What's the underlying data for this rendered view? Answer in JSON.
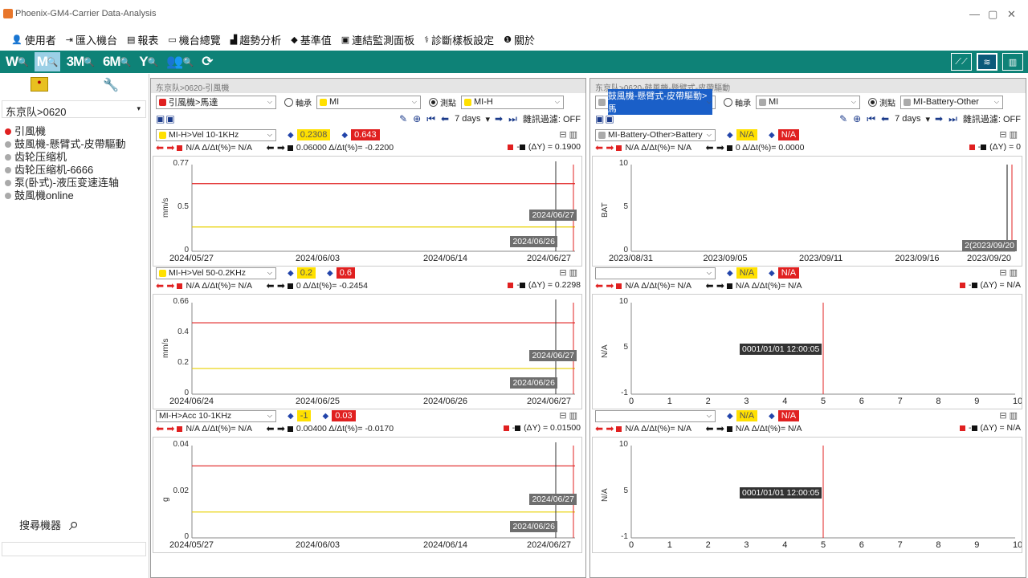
{
  "window": {
    "title": "Phoenix-GM4-Carrier Data-Analysis",
    "min": "—",
    "max": "▢",
    "close": "✕"
  },
  "menu": [
    {
      "icon": "user-icon",
      "glyph": "👤",
      "label": "使用者"
    },
    {
      "icon": "import-icon",
      "glyph": "⇥",
      "label": "匯入機台"
    },
    {
      "icon": "report-icon",
      "glyph": "▤",
      "label": "報表"
    },
    {
      "icon": "overview-icon",
      "glyph": "▭",
      "label": "機台總覽"
    },
    {
      "icon": "trend-icon",
      "glyph": "▟",
      "label": "趨勢分析"
    },
    {
      "icon": "baseline-icon",
      "glyph": "◆",
      "label": "基準值"
    },
    {
      "icon": "monitor-icon",
      "glyph": "▣",
      "label": "連結監測面板"
    },
    {
      "icon": "diagnose-icon",
      "glyph": "⚕",
      "label": "診斷樣板設定"
    },
    {
      "icon": "about-icon",
      "glyph": "❶",
      "label": "關於"
    }
  ],
  "toolbar": {
    "buttons": [
      {
        "name": "week-view-button",
        "label": "W",
        "active": false
      },
      {
        "name": "month-view-button",
        "label": "M",
        "active": true
      },
      {
        "name": "3month-view-button",
        "label": "3M",
        "active": false
      },
      {
        "name": "6month-view-button",
        "label": "6M",
        "active": false
      },
      {
        "name": "year-view-button",
        "label": "Y",
        "active": false
      },
      {
        "name": "user-search-button",
        "label": "👥",
        "active": false
      },
      {
        "name": "refresh-button",
        "label": "⟳",
        "active": false
      }
    ],
    "search_glyph": "🔍"
  },
  "sidebar": {
    "group_select": "东京队>0620",
    "tree": [
      {
        "label": "引風機",
        "status": "red"
      },
      {
        "label": "鼓風機-懸臂式-皮帶驅動",
        "status": "gray"
      },
      {
        "label": "齿轮压缩机",
        "status": "gray"
      },
      {
        "label": "齿轮压缩机-6666",
        "status": "gray"
      },
      {
        "label": "泵(卧式)-液压变速连轴",
        "status": "gray"
      },
      {
        "label": "鼓風機online",
        "status": "gray"
      }
    ],
    "search_label": "搜尋機器"
  },
  "panels": [
    {
      "breadcrumb": "东京队>0620-引風機",
      "machine_select": "引風機>馬達",
      "machine_dot": "#e02020",
      "axis_label": "軸承",
      "axis_select": "MI",
      "point_label": "測點",
      "point_select": "MI-H",
      "range": "7 days",
      "filter": "雜訊過濾: OFF",
      "sections": [
        {
          "select": "MI-H>Vel 10-1KHz",
          "sel_dot": "#ffe000",
          "low": "0.2308",
          "high": "0.643",
          "left_text": "N/A  Δ/Δt(%)=  N/A",
          "mid_text": "0.06000 Δ/Δt(%)=  -0.2200",
          "right_text": "(ΔY) =  0.1900",
          "chart_data": {
            "type": "line",
            "ylabel": "mm/s",
            "yticks": [
              "0.77",
              "0.5",
              "0"
            ],
            "xticks": [
              "2024/05/27",
              "2024/06/03",
              "2024/06/14",
              "2024/06/27"
            ],
            "tips": [
              "2024/06/27",
              "2024/06/26"
            ]
          }
        },
        {
          "select": "MI-H>Vel 50-0.2KHz",
          "sel_dot": "#ffe000",
          "low": "0.2",
          "high": "0.6",
          "left_text": "N/A  Δ/Δt(%)=  N/A",
          "mid_text": "0   Δ/Δt(%)=  -0.2454",
          "right_text": "(ΔY) =  0.2298",
          "chart_data": {
            "type": "line",
            "ylabel": "mm/s",
            "yticks": [
              "0.66",
              "0.4",
              "0.2",
              "0"
            ],
            "xticks": [
              "2024/06/24",
              "2024/06/25",
              "2024/06/26",
              "2024/06/27"
            ],
            "tips": [
              "2024/06/27",
              "2024/06/26"
            ]
          }
        },
        {
          "select": "MI-H>Acc 10-1KHz",
          "sel_dot": "",
          "low": "-1",
          "high": "0.03",
          "left_text": "N/A  Δ/Δt(%)=  N/A",
          "mid_text": "0.00400 Δ/Δt(%)=  -0.0170",
          "right_text": "(ΔY) =  0.01500",
          "chart_data": {
            "type": "line",
            "ylabel": "g",
            "yticks": [
              "0.04",
              "0.02",
              "0"
            ],
            "xticks": [
              "2024/05/27",
              "2024/06/03",
              "2024/06/14",
              "2024/06/27"
            ],
            "tips": [
              "2024/06/27",
              "2024/06/26"
            ]
          }
        }
      ]
    },
    {
      "breadcrumb": "东京队>0620-鼓風機-懸臂式-皮帶驅動",
      "machine_select": "鼓風機-懸臂式-皮帶驅動>馬",
      "machine_dot": "#aaa",
      "axis_label": "軸承",
      "axis_select": "MI",
      "point_label": "測點",
      "point_select": "MI-Battery-Other",
      "range": "7 days",
      "filter": "雜訊過濾: OFF",
      "sections": [
        {
          "select": "MI-Battery-Other>Battery",
          "sel_dot": "#aaa",
          "low": "N/A",
          "high": "N/A",
          "left_text": "N/A  Δ/Δt(%)=  N/A",
          "mid_text": "0         Δ/Δt(%)=  0.0000",
          "right_text": "(ΔY) =      0",
          "chart_data": {
            "type": "line",
            "ylabel": "BAT",
            "yticks": [
              "10",
              "5",
              "0"
            ],
            "xticks": [
              "2023/08/31",
              "2023/09/05",
              "2023/09/11",
              "2023/09/16",
              "2023/09/20"
            ],
            "tips": [
              "2(2023/09/20"
            ]
          }
        },
        {
          "select": "",
          "sel_dot": "",
          "low": "N/A",
          "high": "N/A",
          "left_text": "N/A  Δ/Δt(%)=  N/A",
          "mid_text": "N/A     Δ/Δt(%)=  N/A",
          "right_text": "(ΔY) =    N/A",
          "chart_data": {
            "type": "line",
            "ylabel": "N/A",
            "yticks": [
              "10",
              "5",
              "-1"
            ],
            "xticks": [
              "0",
              "1",
              "2",
              "3",
              "4",
              "5",
              "6",
              "7",
              "8",
              "9",
              "10"
            ],
            "tips": [
              "0001/01/01 12:00:05"
            ]
          }
        },
        {
          "select": "",
          "sel_dot": "",
          "low": "N/A",
          "high": "N/A",
          "left_text": "N/A  Δ/Δt(%)=  N/A",
          "mid_text": "N/A     Δ/Δt(%)=  N/A",
          "right_text": "(ΔY) =    N/A",
          "chart_data": {
            "type": "line",
            "ylabel": "N/A",
            "yticks": [
              "10",
              "5",
              "-1"
            ],
            "xticks": [
              "0",
              "1",
              "2",
              "3",
              "4",
              "5",
              "6",
              "7",
              "8",
              "9",
              "10"
            ],
            "tips": [
              "0001/01/01 12:00:05"
            ]
          }
        }
      ]
    }
  ]
}
